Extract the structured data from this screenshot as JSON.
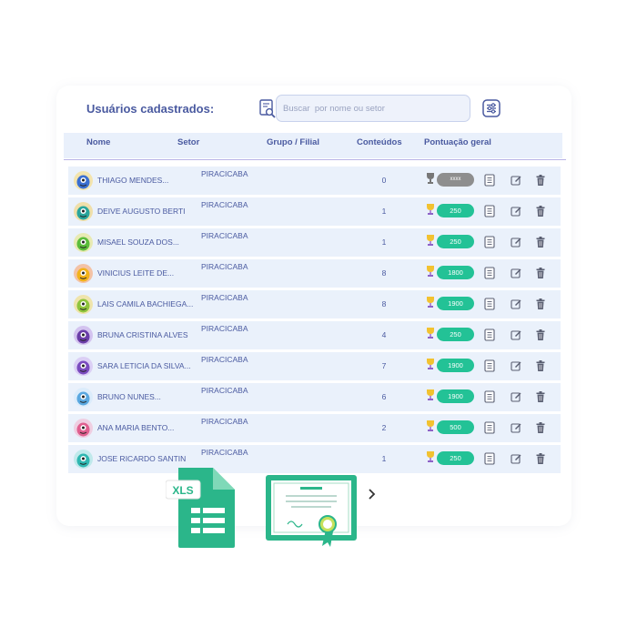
{
  "header": {
    "title": "Usuários cadastrados:",
    "search_placeholder": "Buscar  por nome ou setor"
  },
  "columns": [
    "Nome",
    "Setor",
    "Grupo / Filial",
    "Conteúdos",
    "Pontuação geral"
  ],
  "users": [
    {
      "name": "THIAGO MENDES...",
      "sector": "PIRACICABA",
      "contents": "0",
      "score": "xxxx",
      "avatar": "blue-monster-avatar",
      "score_active": false
    },
    {
      "name": "DEIVE AUGUSTO BERTI",
      "sector": "PIRACICABA",
      "contents": "1",
      "score": "250",
      "avatar": "teal-monster-avatar",
      "score_active": true
    },
    {
      "name": "MISAEL SOUZA DOS...",
      "sector": "PIRACICABA",
      "contents": "1",
      "score": "250",
      "avatar": "green-monster-avatar",
      "score_active": true
    },
    {
      "name": "VINICIUS LEITE DE...",
      "sector": "PIRACICABA",
      "contents": "8",
      "score": "1800",
      "avatar": "yellow-monster-avatar",
      "score_active": true
    },
    {
      "name": "LAIS CAMILA BACHIEGA...",
      "sector": "PIRACICABA",
      "contents": "8",
      "score": "1900",
      "avatar": "lime-monster-avatar",
      "score_active": true
    },
    {
      "name": "BRUNA CRISTINA ALVES",
      "sector": "PIRACICABA",
      "contents": "4",
      "score": "250",
      "avatar": "purple-monster-avatar",
      "score_active": true
    },
    {
      "name": "SARA LETICIA DA SILVA...",
      "sector": "PIRACICABA",
      "contents": "7",
      "score": "1900",
      "avatar": "violet-monster-avatar",
      "score_active": true
    },
    {
      "name": "BRUNO NUNES...",
      "sector": "PIRACICABA",
      "contents": "6",
      "score": "1900",
      "avatar": "lightblue-monster-avatar",
      "score_active": true
    },
    {
      "name": "ANA MARIA BENTO...",
      "sector": "PIRACICABA",
      "contents": "2",
      "score": "500",
      "avatar": "pink-monster-avatar",
      "score_active": true
    },
    {
      "name": "JOSE RICARDO SANTIN",
      "sector": "PIRACICABA",
      "contents": "1",
      "score": "250",
      "avatar": "cyan-monster-avatar",
      "score_active": true
    }
  ],
  "footer": {
    "xls_label": "XLS",
    "next_icon": "chevron-right-icon"
  },
  "colors": {
    "accent": "#4a5aa0",
    "score_green": "#23c296",
    "score_gray": "#8e8e8e",
    "row_bg": "#eaf1fb"
  }
}
